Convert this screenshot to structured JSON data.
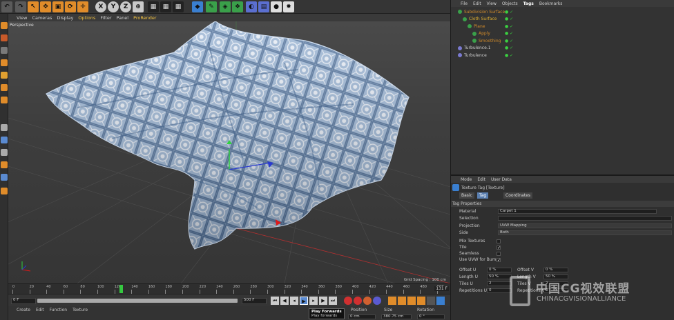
{
  "viewport": {
    "menu": [
      "View",
      "Cameras",
      "Display",
      "Options",
      "Filter",
      "Panel",
      "ProRender"
    ],
    "label": "Perspective",
    "grid_spacing": "Grid Spacing : 100 cm"
  },
  "toolbar": {
    "x_label": "X",
    "y_label": "Y",
    "z_label": "Z"
  },
  "timeline": {
    "ticks": [
      "0",
      "20",
      "40",
      "60",
      "80",
      "100",
      "120",
      "140",
      "160",
      "180",
      "200",
      "220",
      "240",
      "260",
      "280",
      "300",
      "320",
      "340",
      "360",
      "380",
      "400",
      "420",
      "440",
      "460",
      "480",
      "500"
    ],
    "current_frame": "131",
    "end_value": "131 F"
  },
  "transport": {
    "start_field": "0 F",
    "end_field": "500 F",
    "frame_field": "0 F"
  },
  "tooltip": {
    "title": "Play Forwards",
    "subtitle": "Play forwards"
  },
  "material_panel": {
    "menu": [
      "Create",
      "Edit",
      "Function",
      "Texture"
    ],
    "cols": [
      "Position",
      "Size",
      "Rotation"
    ],
    "pos_val": "0 cm",
    "size_val": "380.75 cm",
    "rot_val": "0 °"
  },
  "object_manager": {
    "menu": [
      "File",
      "Edit",
      "View",
      "Objects",
      "Tags",
      "Bookmarks"
    ],
    "objects": [
      {
        "name": "Subdivision Surface",
        "color": "#d08a2a",
        "indent": 0
      },
      {
        "name": "Cloth Surface",
        "color": "#e0b030",
        "indent": 1
      },
      {
        "name": "Plane",
        "color": "#d08a2a",
        "indent": 2
      },
      {
        "name": "Apply",
        "color": "#d08a2a",
        "indent": 3
      },
      {
        "name": "Smoothing",
        "color": "#d08a2a",
        "indent": 3
      },
      {
        "name": "Turbulence.1",
        "color": "#cfcfcf",
        "indent": 0
      },
      {
        "name": "Turbulence",
        "color": "#cfcfcf",
        "indent": 0
      }
    ]
  },
  "attribute_manager": {
    "menu": [
      "Mode",
      "Edit",
      "User Data"
    ],
    "title": "Texture Tag [Texture]",
    "tabs": [
      "Basic",
      "Tag",
      "Coordinates"
    ],
    "section": "Tag Properties",
    "material_label": "Material",
    "material_value": "Carpet 1",
    "selection_label": "Selection",
    "projection_label": "Projection",
    "projection_value": "UVW Mapping",
    "side_label": "Side",
    "side_value": "Both",
    "mix_label": "Mix Textures",
    "tile_label": "Tile",
    "seamless_label": "Seamless",
    "uvw_bump_label": "Use UVW for Bump",
    "offset_u_label": "Offset U",
    "offset_u": "0 %",
    "offset_v_label": "Offset V",
    "offset_v": "0 %",
    "length_u_label": "Length U",
    "length_u": "50 %",
    "length_v_label": "Length V",
    "length_v": "50 %",
    "tiles_u_label": "Tiles U",
    "tiles_u": "2",
    "tiles_v_label": "Tiles V",
    "tiles_v": "2",
    "repetitions_u_label": "Repetitions U",
    "repetitions_u": "0",
    "repetitions_v_label": "Repetitions V",
    "repetitions_v": "0"
  },
  "watermark": {
    "cn": "中国CG视效联盟",
    "en": "CHINACGVISIONALLIANCE"
  }
}
